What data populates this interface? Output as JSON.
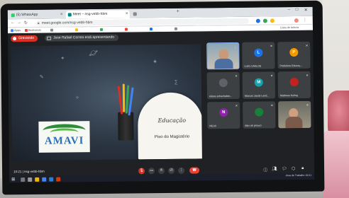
{
  "browser": {
    "tabs": [
      {
        "label": "(5) WhatsApp"
      },
      {
        "label": "Meet – nsg-vebb-hbm"
      },
      {
        "label": ""
      }
    ],
    "url": "meet.google.com/nsg-vebb-hbm",
    "bookmarks": [
      "Apps",
      "Bemvindo",
      "",
      "",
      "",
      "",
      "",
      ""
    ],
    "right_bookmark": "Lista de leitura"
  },
  "meet": {
    "record_label": "Gravando",
    "presenter_label": "Jose Rafael Correa está apresentando",
    "slide": {
      "title": "Educação",
      "subtitle": "Piso do Magistério",
      "logo_text": "AMAVI"
    },
    "participants": [
      {
        "name": "",
        "initial": "",
        "color": "#4285f4",
        "video": true
      },
      {
        "name": "LUIS CARLOS",
        "initial": "L",
        "color": "#1a73e8"
      },
      {
        "name": "Prefeitura Educaç...",
        "initial": "P",
        "color": "#f29900"
      },
      {
        "name": "eliane schacheber...",
        "initial": "",
        "color": "#5f6368"
      },
      {
        "name": "Marcos Jacob Lend...",
        "initial": "M",
        "color": "#12a4af"
      },
      {
        "name": "Matheus Kuling",
        "initial": "",
        "color": "#c5221f"
      },
      {
        "name": "NILNI",
        "initial": "N",
        "color": "#8e24aa"
      },
      {
        "name": "daiv ok proxxo",
        "initial": "",
        "color": "#188038"
      },
      {
        "name": "",
        "initial": "",
        "color": "#5f6368",
        "video": true
      }
    ],
    "time": "10:21",
    "meeting_code": "nsg-vebb-hbm"
  },
  "taskbar": {
    "tray_text": "Área de Trabalho",
    "clock": "10:21"
  }
}
